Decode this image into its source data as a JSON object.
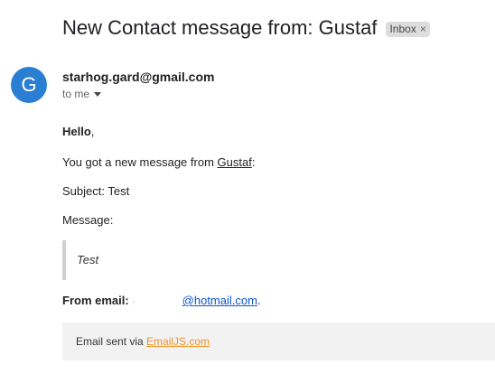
{
  "email": {
    "subject": "New Contact message from: Gustaf",
    "label_chip": "Inbox",
    "label_chip_close": "×",
    "avatar_letter": "G",
    "sender": "starhog.gard@gmail.com",
    "recipient": "to me"
  },
  "body": {
    "greeting": "Hello",
    "greeting_punct": ",",
    "intro_prefix": "You got a new message from ",
    "intro_name": "Gustaf",
    "intro_suffix": ":",
    "subject_line": "Subject: Test",
    "message_label": "Message:",
    "message_text": "Test",
    "from_label": "From email:",
    "from_prefix": "·",
    "from_link": "@hotmail.com",
    "from_suffix": "."
  },
  "footer": {
    "text": "Email sent via ",
    "link": "EmailJS.com"
  },
  "colors": {
    "avatar": "#2a7fd2",
    "link": "#1155cc",
    "emailjs_link": "#f0922a",
    "chip_bg": "#dddddd",
    "footer_bg": "#f2f2f2"
  }
}
